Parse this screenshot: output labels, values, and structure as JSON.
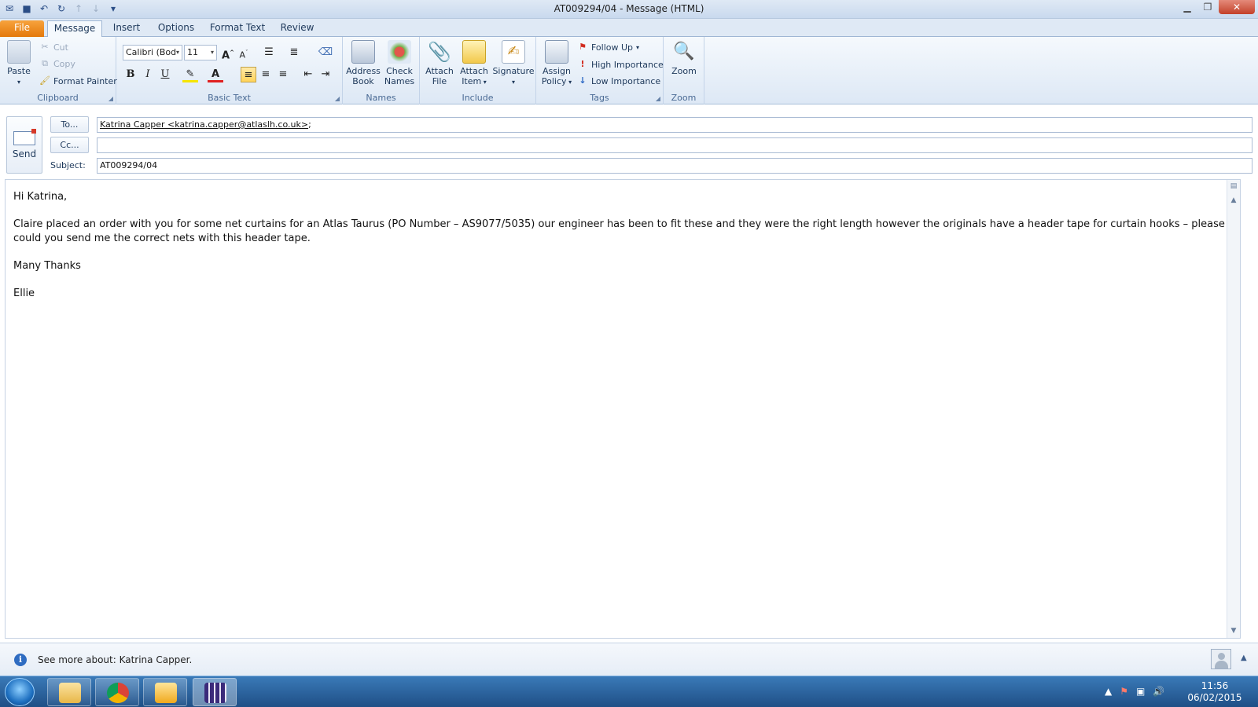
{
  "window": {
    "title": "AT009294/04  -  Message (HTML)"
  },
  "tabs": {
    "file": "File",
    "message": "Message",
    "insert": "Insert",
    "options": "Options",
    "format_text": "Format Text",
    "review": "Review"
  },
  "ribbon": {
    "clipboard": {
      "paste": "Paste",
      "cut": "Cut",
      "copy": "Copy",
      "format_painter": "Format Painter",
      "label": "Clipboard"
    },
    "basic_text": {
      "font": "Calibri (Bod",
      "size": "11",
      "bold": "B",
      "italic": "I",
      "underline": "U",
      "label": "Basic Text"
    },
    "names": {
      "address_book": "Address Book",
      "check_names": "Check Names",
      "label": "Names"
    },
    "include": {
      "attach_file": "Attach File",
      "attach_item": "Attach Item",
      "signature": "Signature",
      "label": "Include"
    },
    "tags": {
      "assign_policy": "Assign Policy",
      "follow_up": "Follow Up",
      "high_importance": "High Importance",
      "low_importance": "Low Importance",
      "label": "Tags"
    },
    "zoom": {
      "zoom": "Zoom",
      "label": "Zoom"
    }
  },
  "header": {
    "send": "Send",
    "to_button": "To...",
    "cc_button": "Cc...",
    "subject_label": "Subject:",
    "to_value": "Katrina Capper <katrina.capper@atlaslh.co.uk>",
    "to_suffix": ";",
    "cc_value": "",
    "subject_value": "AT009294/04"
  },
  "body": {
    "greeting": "Hi Katrina,",
    "paragraph": "Claire placed an order with you for some net curtains for an Atlas Taurus (PO Number – AS9077/5035) our engineer has been to fit these and they were the right length however the originals have a header tape for curtain hooks – please could you send me the correct nets with this header tape.",
    "closing": "Many Thanks",
    "signature": "Ellie"
  },
  "people_pane": {
    "text": "See more about: Katrina Capper."
  },
  "taskbar": {
    "time": "11:56",
    "date": "06/02/2015"
  },
  "colors": {
    "file_tab": "#e4790b",
    "accent": "#1e395b",
    "taskbar": "#1f4f86"
  }
}
